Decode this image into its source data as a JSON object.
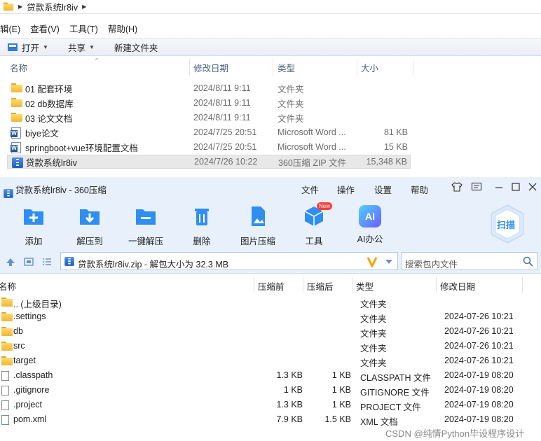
{
  "explorer": {
    "breadcrumb": "贷款系统lr8iv",
    "menu": [
      "辑(E)",
      "查看(V)",
      "工具(T)",
      "帮助(H)"
    ],
    "commands": {
      "open": "打开",
      "share": "共享",
      "new_folder": "新建文件夹"
    },
    "columns": {
      "name": "名称",
      "date": "修改日期",
      "type": "类型",
      "size": "大小"
    },
    "rows": [
      {
        "name": "01 配套环境",
        "date": "2024/8/11 9:11",
        "type": "文件夹",
        "size": "",
        "icon": "folder-icon"
      },
      {
        "name": "02 db数据库",
        "date": "2024/8/11 9:11",
        "type": "文件夹",
        "size": "",
        "icon": "folder-icon"
      },
      {
        "name": "03 论文文档",
        "date": "2024/8/11 9:11",
        "type": "文件夹",
        "size": "",
        "icon": "folder-icon"
      },
      {
        "name": "biye论文",
        "date": "2024/7/25 20:51",
        "type": "Microsoft Word ...",
        "size": "81 KB",
        "icon": "word-icon"
      },
      {
        "name": "springboot+vue环境配置文档",
        "date": "2024/7/25 20:51",
        "type": "Microsoft Word ...",
        "size": "15 KB",
        "icon": "word-icon"
      },
      {
        "name": "贷款系统lr8iv",
        "date": "2024/7/26 10:22",
        "type": "360压缩 ZIP 文件",
        "size": "15,348 KB",
        "icon": "zip-icon"
      }
    ]
  },
  "zip": {
    "title": "贷款系统lr8iv - 360压缩",
    "menu": {
      "file": "文件",
      "op": "操作",
      "settings": "设置",
      "help": "帮助"
    },
    "toolbar": {
      "add": "添加",
      "extract_to": "解压到",
      "one_click": "一键解压",
      "delete": "删除",
      "image_compress": "图片压缩",
      "tools": "工具",
      "new_badge": "New",
      "ai_office": "AI办公",
      "scan": "扫描",
      "ai": "AI"
    },
    "path": "贷款系统lr8iv.zip - 解包大小为 32.3 MB",
    "search_placeholder": "搜索包内文件",
    "columns": {
      "name": "名称",
      "compressed": "压缩前",
      "after": "压缩后",
      "type": "类型",
      "date": "修改日期"
    },
    "rows": [
      {
        "name": ".. (上级目录)",
        "c1": "",
        "c2": "",
        "type": "文件夹",
        "date": "",
        "icon": "folder-icon"
      },
      {
        "name": ".settings",
        "c1": "",
        "c2": "",
        "type": "文件夹",
        "date": "2024-07-26 10:21",
        "icon": "folder-icon"
      },
      {
        "name": "db",
        "c1": "",
        "c2": "",
        "type": "文件夹",
        "date": "2024-07-26 10:21",
        "icon": "folder-icon"
      },
      {
        "name": "src",
        "c1": "",
        "c2": "",
        "type": "文件夹",
        "date": "2024-07-26 10:21",
        "icon": "folder-icon"
      },
      {
        "name": "target",
        "c1": "",
        "c2": "",
        "type": "文件夹",
        "date": "2024-07-26 10:21",
        "icon": "folder-icon"
      },
      {
        "name": ".classpath",
        "c1": "1.3 KB",
        "c2": "1 KB",
        "type": "CLASSPATH 文件",
        "date": "2024-07-19 08:20",
        "icon": "file-icon"
      },
      {
        "name": ".gitignore",
        "c1": "1 KB",
        "c2": "1 KB",
        "type": "GITIGNORE 文件",
        "date": "2024-07-19 08:20",
        "icon": "file-icon"
      },
      {
        "name": ".project",
        "c1": "1.3 KB",
        "c2": "1 KB",
        "type": "PROJECT 文件",
        "date": "2024-07-19 08:20",
        "icon": "file-icon"
      },
      {
        "name": "pom.xml",
        "c1": "7.9 KB",
        "c2": "1.5 KB",
        "type": "XML 文档",
        "date": "2024-07-19 08:20",
        "icon": "xml-file-icon"
      }
    ]
  },
  "watermark": "CSDN @纯情Python毕设程序设计"
}
